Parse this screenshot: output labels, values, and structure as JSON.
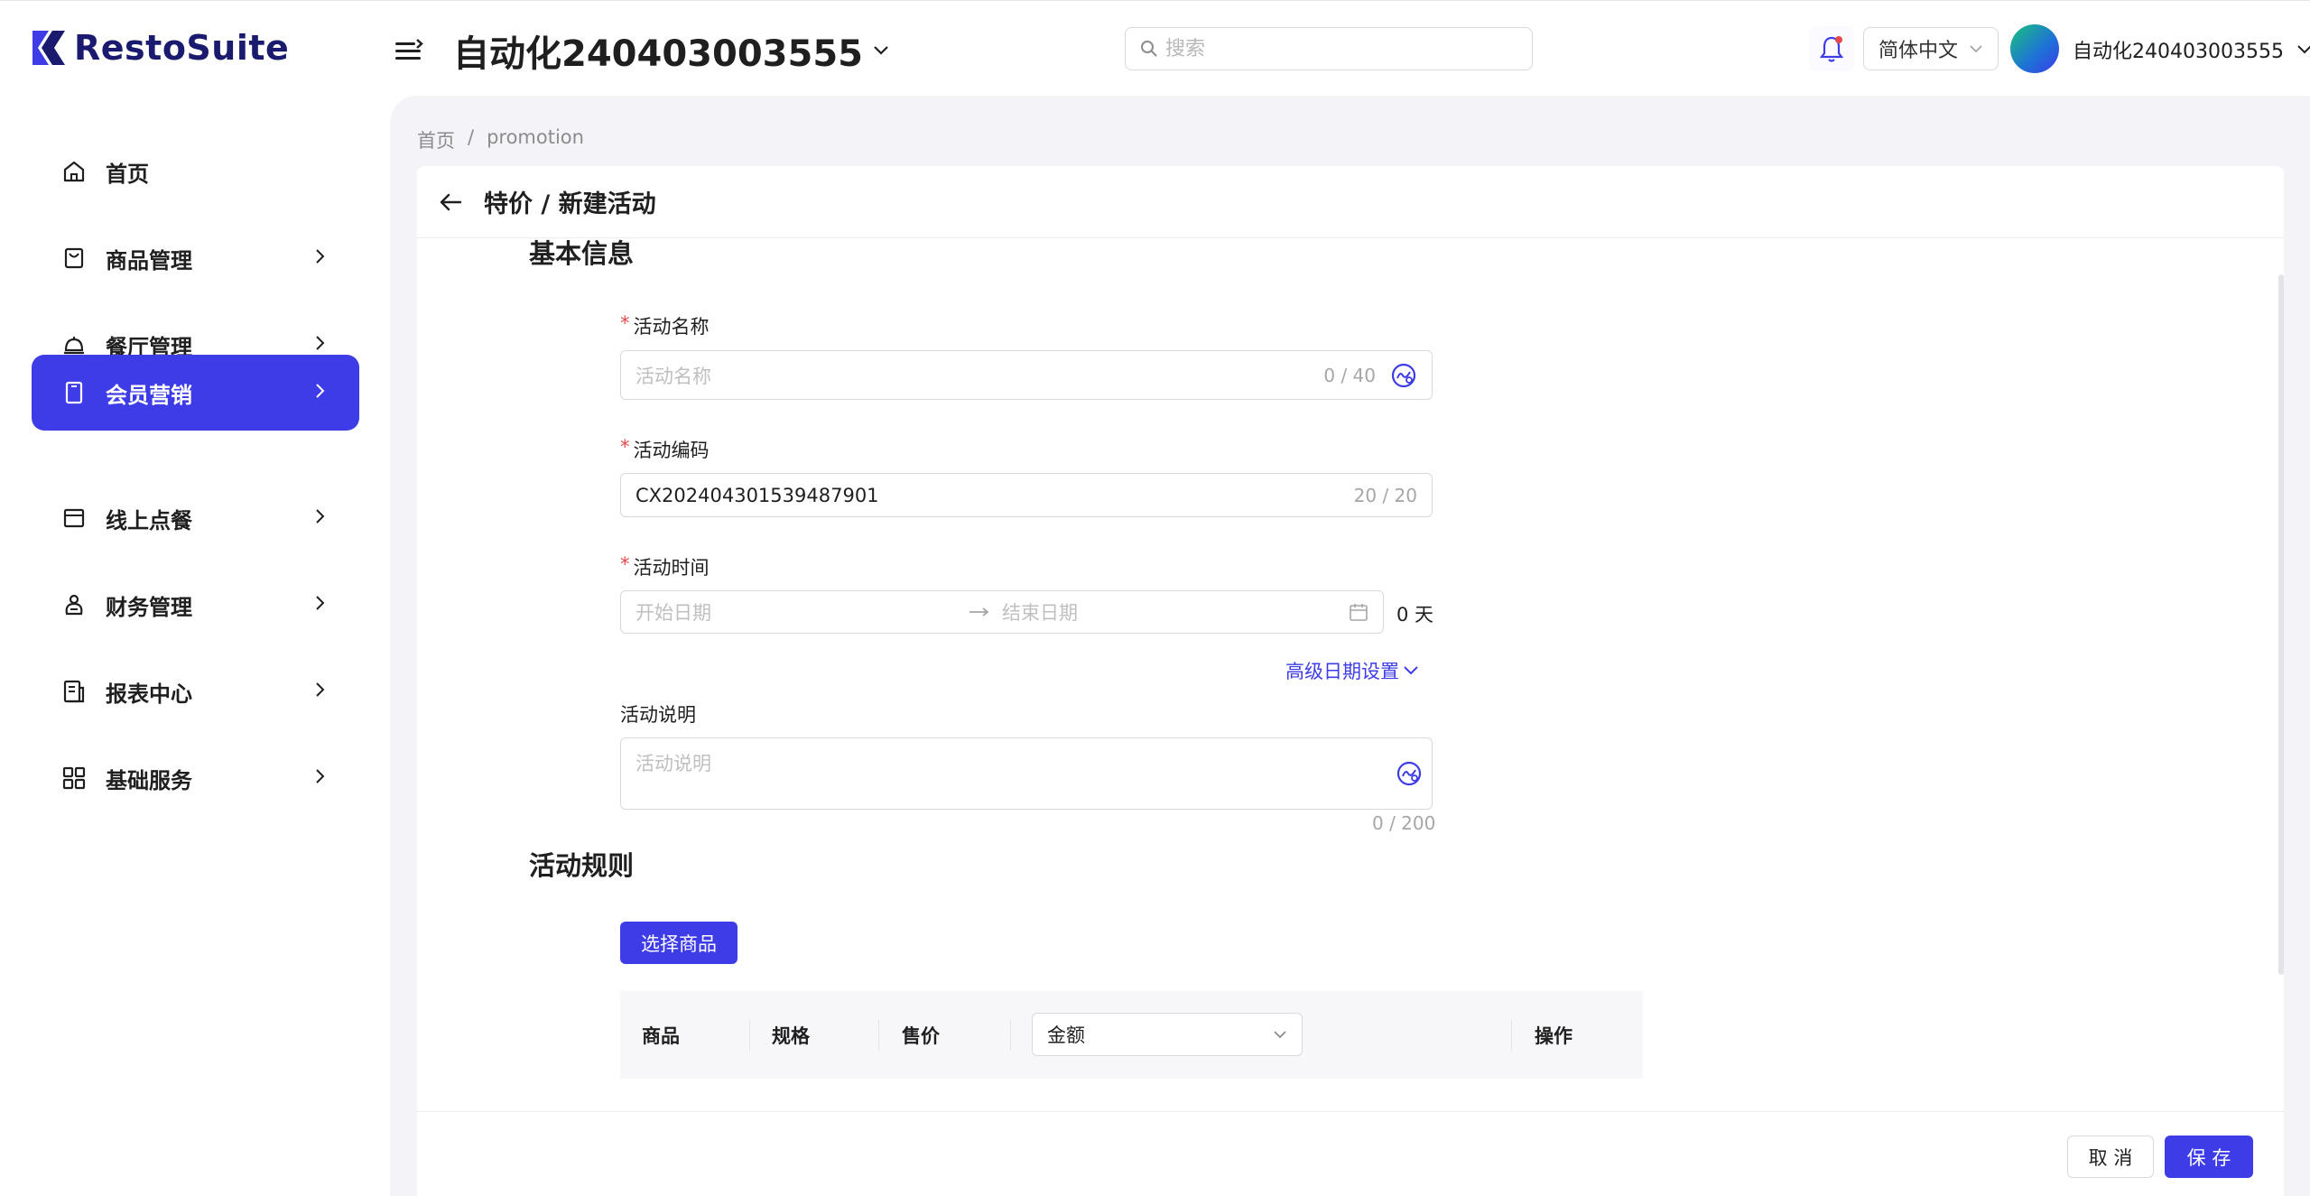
{
  "app": {
    "brand_name": "RestoSuite",
    "brand_color": "#3d3ce6"
  },
  "header": {
    "store_name": "自动化240403003555",
    "search_placeholder": "搜索",
    "language": "简体中文",
    "user_name": "自动化240403003555"
  },
  "sidebar": {
    "items": [
      {
        "label": "首页",
        "icon": "home-icon"
      },
      {
        "label": "商品管理",
        "icon": "shopping-bag-icon"
      },
      {
        "label": "餐厅管理",
        "icon": "service-bell-icon"
      },
      {
        "label": "会员营销",
        "icon": "tablet-icon",
        "active": true
      },
      {
        "label": "线上点餐",
        "icon": "store-box-icon"
      },
      {
        "label": "财务管理",
        "icon": "money-bag-icon"
      },
      {
        "label": "报表中心",
        "icon": "report-icon"
      },
      {
        "label": "基础服务",
        "icon": "grid-icon"
      }
    ]
  },
  "breadcrumb": {
    "home": "首页",
    "separator": "/",
    "current": "promotion"
  },
  "page": {
    "title": "特价 / 新建活动"
  },
  "basic_info": {
    "section_title": "基本信息",
    "activity_name": {
      "label": "活动名称",
      "placeholder": "活动名称",
      "count": "0 / 40"
    },
    "activity_code": {
      "label": "活动编码",
      "value": "CX202404301539487901",
      "count": "20 / 20"
    },
    "activity_time": {
      "label": "活动时间",
      "start_placeholder": "开始日期",
      "end_placeholder": "结束日期",
      "days": "0 天"
    },
    "advanced_date_link": "高级日期设置",
    "description": {
      "label": "活动说明",
      "placeholder": "活动说明",
      "count": "0 / 200"
    }
  },
  "rules": {
    "section_title": "活动规则",
    "select_product_button": "选择商品",
    "table": {
      "columns": [
        "商品",
        "规格",
        "售价",
        "操作"
      ],
      "amount_select": "金额"
    }
  },
  "footer": {
    "cancel": "取 消",
    "save": "保 存"
  }
}
